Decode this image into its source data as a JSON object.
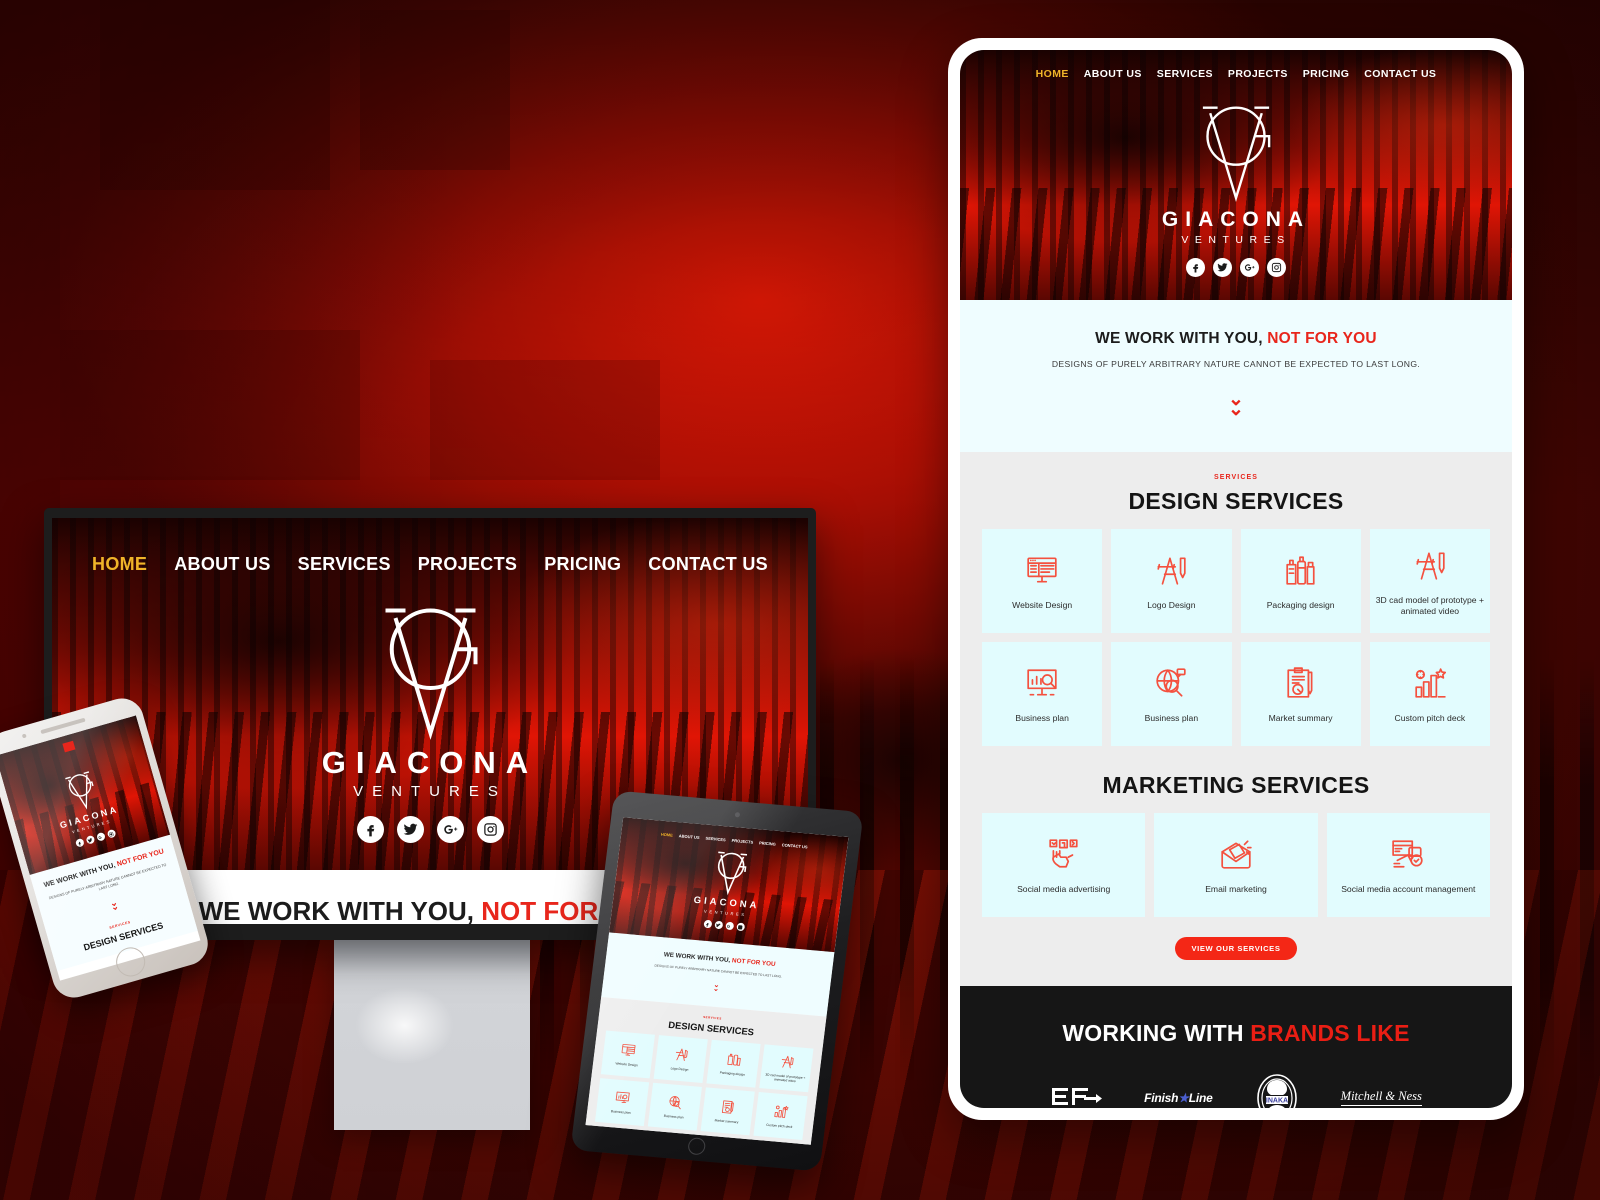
{
  "brand": {
    "name": "GIACONA",
    "subtitle": "VENTURES",
    "accent_red": "#e8261c",
    "accent_gold": "#f0b429",
    "card_bg": "#e2fcfe",
    "section_bg": "#ededed",
    "footer_bg": "#161616"
  },
  "nav": {
    "items": [
      {
        "label": "HOME",
        "active": true
      },
      {
        "label": "ABOUT US",
        "active": false
      },
      {
        "label": "SERVICES",
        "active": false
      },
      {
        "label": "PROJECTS",
        "active": false
      },
      {
        "label": "PRICING",
        "active": false
      },
      {
        "label": "CONTACT US",
        "active": false
      }
    ]
  },
  "socials": [
    {
      "name": "facebook-icon",
      "glyph": "f"
    },
    {
      "name": "twitter-icon",
      "glyph": "t"
    },
    {
      "name": "google-plus-icon",
      "glyph": "G+"
    },
    {
      "name": "instagram-icon",
      "glyph": "ig"
    }
  ],
  "statement": {
    "heading_black": "WE WORK WITH YOU,",
    "heading_red": "NOT FOR YOU",
    "sub": "DESIGNS OF PURELY ARBITRARY NATURE CANNOT BE EXPECTED TO LAST LONG.",
    "scroll_icon": "double-chevron-down-icon"
  },
  "services": {
    "eyebrow": "SERVICES",
    "design_title": "DESIGN SERVICES",
    "marketing_title": "MARKETING SERVICES",
    "cta": "VIEW OUR SERVICES",
    "design_items": [
      {
        "label": "Website Design",
        "icon": "monitor-layout-icon"
      },
      {
        "label": "Logo Design",
        "icon": "easel-pencil-icon"
      },
      {
        "label": "Packaging design",
        "icon": "bottles-package-icon"
      },
      {
        "label": "3D cad model of prototype + animated video",
        "icon": "easel-pencil-icon"
      },
      {
        "label": "Business plan",
        "icon": "chart-magnifier-icon"
      },
      {
        "label": "Business plan",
        "icon": "globe-magnifier-icon"
      },
      {
        "label": "Market summary",
        "icon": "clipboard-pen-icon"
      },
      {
        "label": "Custom pitch deck",
        "icon": "bar-chart-star-icon"
      }
    ],
    "marketing_items": [
      {
        "label": "Social media advertising",
        "icon": "hand-social-icons"
      },
      {
        "label": "Email marketing",
        "icon": "envelope-megaphone-icon"
      },
      {
        "label": "Social media account management",
        "icon": "screen-chat-icon"
      }
    ]
  },
  "brands_section": {
    "heading_white": "WORKING WITH",
    "heading_red": "BRANDS LIKE",
    "logos": [
      {
        "name": "ef-logo",
        "text": "EF"
      },
      {
        "name": "finish-line-logo",
        "text": "Finish",
        "text2": "Line",
        "star": "★"
      },
      {
        "name": "inaka-power-logo",
        "text": "INAKA"
      },
      {
        "name": "mitchell-and-ness-logo",
        "text": "Mitchell & Ness"
      }
    ]
  }
}
